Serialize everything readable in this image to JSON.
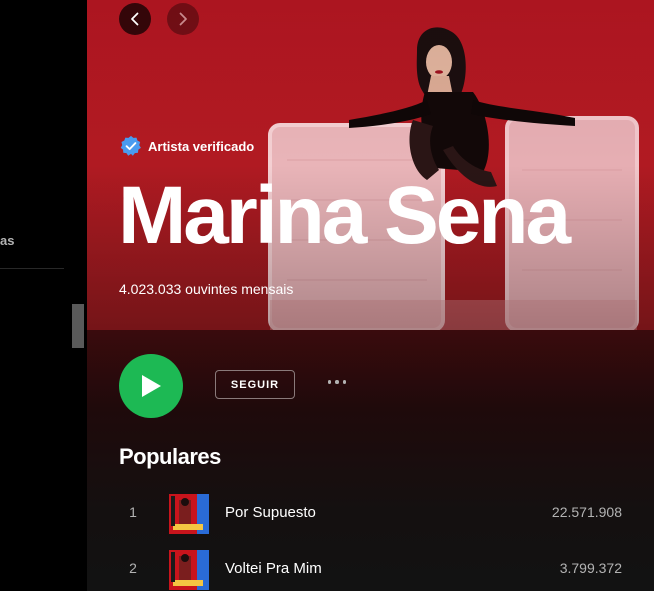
{
  "sidebar": {
    "partial_label": "as"
  },
  "nav": {
    "back_icon": "chevron-left-icon",
    "forward_icon": "chevron-right-icon"
  },
  "artist": {
    "verified_label": "Artista verificado",
    "name": "Marina Sena",
    "monthly_listeners": "4.023.033 ouvintes mensais"
  },
  "actions": {
    "play_icon": "play-icon",
    "follow_label": "SEGUIR",
    "more_icon": "more-dots-icon"
  },
  "popular": {
    "title": "Populares",
    "tracks": [
      {
        "number": "1",
        "title": "Por Supuesto",
        "plays": "22.571.908"
      },
      {
        "number": "2",
        "title": "Voltei Pra Mim",
        "plays": "3.799.372"
      }
    ]
  },
  "colors": {
    "hero_bg": "#b51622",
    "play_green": "#1db954",
    "verified_blue": "#4a9bef"
  }
}
